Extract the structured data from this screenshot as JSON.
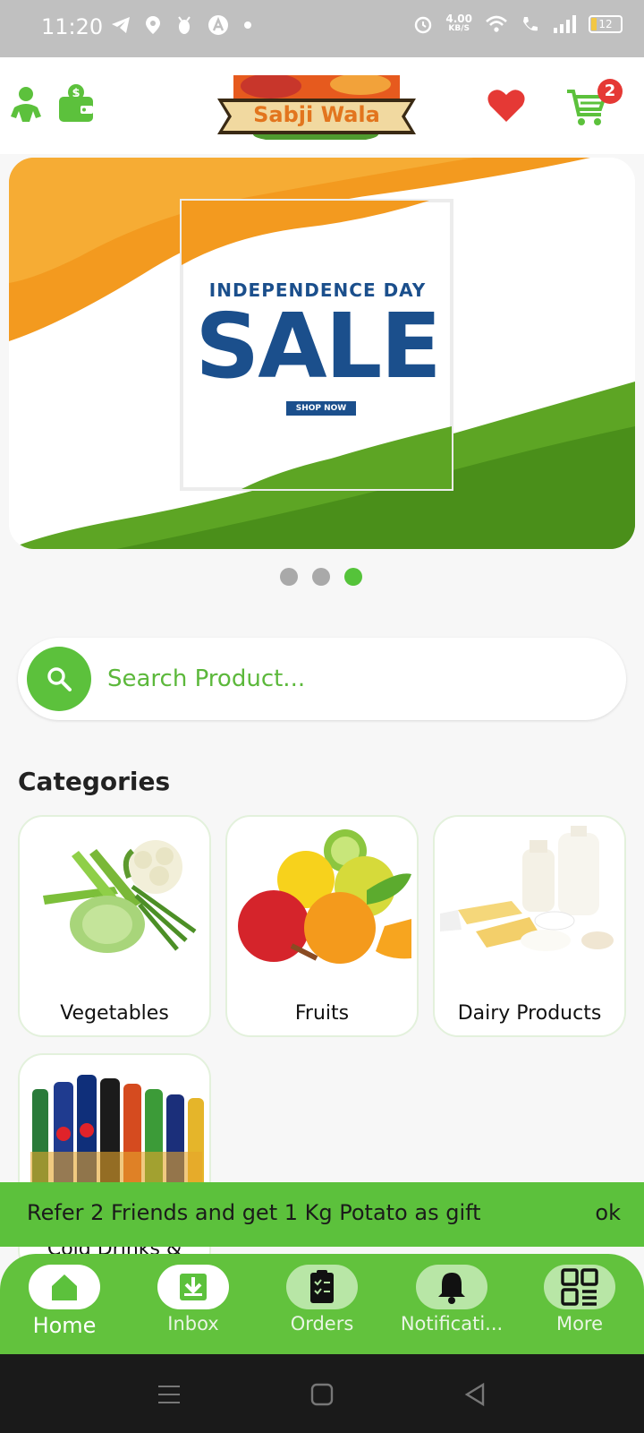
{
  "status_bar": {
    "time": "11:20",
    "speed_value": "4.00",
    "speed_unit": "KB/S",
    "battery": "12"
  },
  "header": {
    "logo_text": "Sabji Wala",
    "cart_count": "2"
  },
  "banner": {
    "line1": "INDEPENDENCE DAY",
    "line2": "SALE",
    "cta": "SHOP NOW",
    "slide_count": 3,
    "active_slide": 3
  },
  "search": {
    "placeholder": "Search Product..."
  },
  "categories": {
    "title": "Categories",
    "items": [
      {
        "label": "Vegetables"
      },
      {
        "label": "Fruits"
      },
      {
        "label": "Dairy Products"
      },
      {
        "label": "Cold Drinks &"
      }
    ]
  },
  "snackbar": {
    "message": "Refer 2 Friends and get 1 Kg Potato as gift",
    "action": "ok"
  },
  "bottom_nav": {
    "items": [
      {
        "label": "Home",
        "icon": "home-icon",
        "active": true
      },
      {
        "label": "Inbox",
        "icon": "inbox-icon"
      },
      {
        "label": "Orders",
        "icon": "orders-icon"
      },
      {
        "label": "Notificati...",
        "icon": "bell-icon"
      },
      {
        "label": "More",
        "icon": "grid-icon"
      }
    ]
  },
  "colors": {
    "brand_green": "#5cc13c",
    "heart_red": "#e53935",
    "banner_blue": "#1b4f8c",
    "saffron": "#f39a1f"
  }
}
